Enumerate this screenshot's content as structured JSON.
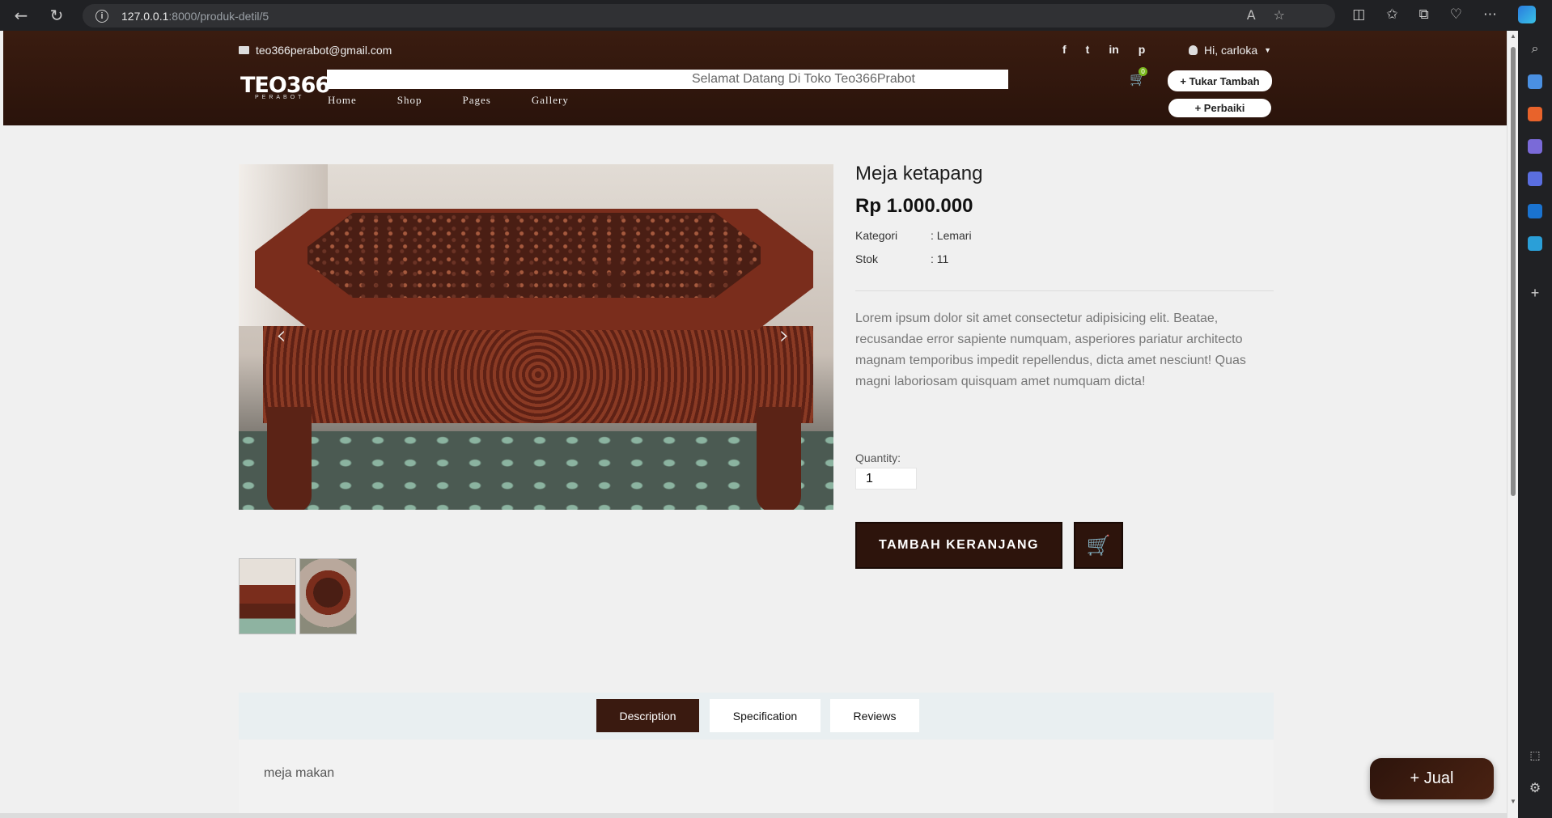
{
  "browser": {
    "url_host": "127.0.0.1",
    "url_rest": ":8000/produk-detil/5"
  },
  "header": {
    "email": "teo366perabot@gmail.com",
    "user_greeting": "Hi, carloka",
    "welcome_text": "Selamat Datang Di Toko Teo366Prabot",
    "logo_main": "TEO366",
    "logo_sub": "PERABOT",
    "cart_count": "0",
    "nav": [
      "Home",
      "Shop",
      "Pages",
      "Gallery"
    ],
    "buttons": {
      "tukar": "+ Tukar Tambah",
      "perbaiki": "+ Perbaiki"
    },
    "social_icons": [
      "facebook-icon",
      "twitter-icon",
      "linkedin-icon",
      "pinterest-icon"
    ]
  },
  "product": {
    "title": "Meja ketapang",
    "price": "Rp 1.000.000",
    "category_label": "Kategori",
    "category_value": ": Lemari",
    "stock_label": "Stok",
    "stock_value": ": 11",
    "description": "Lorem ipsum dolor sit amet consectetur adipisicing elit. Beatae, recusandae error sapiente numquam, asperiores pariatur architecto magnam temporibus impedit repellendus, dicta amet nesciunt! Quas magni laboriosam quisquam amet numquam dicta!",
    "quantity_label": "Quantity:",
    "quantity_value": "1",
    "add_to_cart_label": "TAMBAH KERANJANG"
  },
  "tabs": {
    "items": [
      "Description",
      "Specification",
      "Reviews"
    ],
    "active": "Description",
    "content": "meja makan"
  },
  "floating": {
    "jual_label": "+ Jual"
  },
  "colors": {
    "header_bg": "#2a130b",
    "button_bg": "#2d140c",
    "badge": "#7bb81e"
  }
}
